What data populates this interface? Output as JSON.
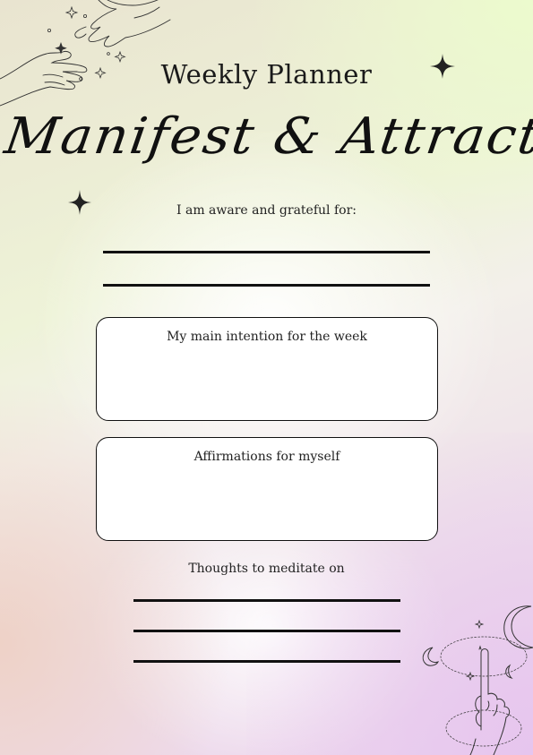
{
  "planner": {
    "title": "Weekly Planner",
    "script_title": "Manifest & Attract",
    "gratitude_prompt": "I am aware and grateful for:",
    "intention_label": "My main intention for the week",
    "affirmations_label": "Affirmations for myself",
    "thoughts_prompt": "Thoughts to meditate on"
  },
  "decorations": {
    "top_left": "reaching-hands-illustration",
    "sparkle": "four-point-sparkle-icon",
    "bottom_right": "hand-with-moons-illustration"
  },
  "colors": {
    "ink": "#111111",
    "box_fill": "#ffffff"
  }
}
